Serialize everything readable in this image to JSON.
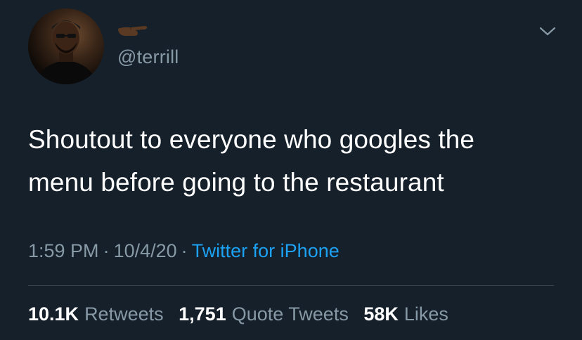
{
  "colors": {
    "background": "#15202b",
    "text_primary": "#ffffff",
    "text_secondary": "#8899a6",
    "link": "#1da1f2",
    "divider": "#38444d"
  },
  "user": {
    "avatar_icon": "user-avatar",
    "name_emoji_icon": "pointing-hand-left-emoji",
    "handle": "@terrill"
  },
  "menu": {
    "icon": "chevron-down-icon"
  },
  "tweet": {
    "text": "Shoutout to everyone who googles the\nmenu before going to the restaurant",
    "time": "1:59 PM",
    "date": "10/4/20",
    "separator": "·",
    "source": "Twitter for iPhone"
  },
  "stats": {
    "retweets_count": "10.1K",
    "retweets_label": "Retweets",
    "quotes_count": "1,751",
    "quotes_label": "Quote Tweets",
    "likes_count": "58K",
    "likes_label": "Likes"
  }
}
